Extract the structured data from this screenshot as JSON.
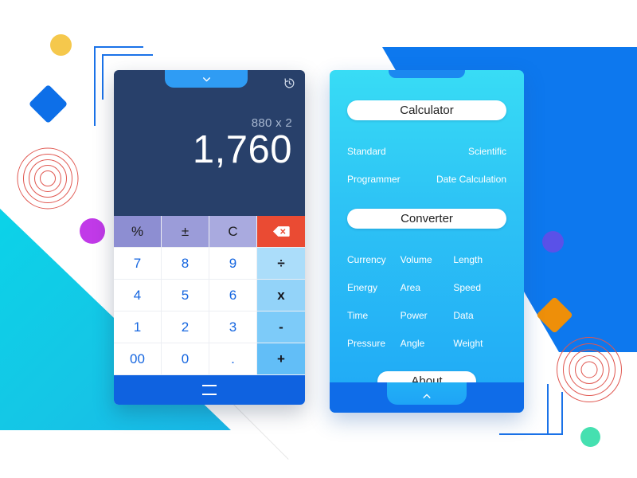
{
  "calculator": {
    "tab_icon": "chevron-down-icon",
    "history_icon": "history-icon",
    "expression": "880 x 2",
    "result": "1,760",
    "keys": [
      {
        "label": "%",
        "name": "percent",
        "style": "fn fn1"
      },
      {
        "label": "±",
        "name": "sign",
        "style": "fn fn2"
      },
      {
        "label": "C",
        "name": "clear",
        "style": "fn fn3"
      },
      {
        "label": "",
        "name": "backspace",
        "style": "fn fn-del"
      },
      {
        "label": "7",
        "name": "seven",
        "style": ""
      },
      {
        "label": "8",
        "name": "eight",
        "style": ""
      },
      {
        "label": "9",
        "name": "nine",
        "style": ""
      },
      {
        "label": "÷",
        "name": "divide",
        "style": "op1"
      },
      {
        "label": "4",
        "name": "four",
        "style": ""
      },
      {
        "label": "5",
        "name": "five",
        "style": ""
      },
      {
        "label": "6",
        "name": "six",
        "style": ""
      },
      {
        "label": "x",
        "name": "multiply",
        "style": "op2"
      },
      {
        "label": "1",
        "name": "one",
        "style": ""
      },
      {
        "label": "2",
        "name": "two",
        "style": ""
      },
      {
        "label": "3",
        "name": "three",
        "style": ""
      },
      {
        "label": "-",
        "name": "subtract",
        "style": "op3"
      },
      {
        "label": "00",
        "name": "double-zero",
        "style": ""
      },
      {
        "label": "0",
        "name": "zero",
        "style": ""
      },
      {
        "label": ".",
        "name": "decimal",
        "style": ""
      },
      {
        "label": "+",
        "name": "add",
        "style": "op4"
      }
    ],
    "equals_label": "="
  },
  "menu": {
    "calculator_title": "Calculator",
    "calculator_modes": [
      "Standard",
      "Scientific",
      "Programmer",
      "Date Calculation"
    ],
    "converter_title": "Converter",
    "converter_items": [
      "Currency",
      "Volume",
      "Length",
      "Energy",
      "Area",
      "Speed",
      "Time",
      "Power",
      "Data",
      "Pressure",
      "Angle",
      "Weight"
    ],
    "about_label": "About",
    "collapse_icon": "chevron-up-icon"
  },
  "decorations": [
    {
      "name": "yellow-circle",
      "color": "#f5c84c"
    },
    {
      "name": "blue-diamond",
      "color": "#0d6fe8"
    },
    {
      "name": "red-concentric-rings-left",
      "color": "#e0564f"
    },
    {
      "name": "purple-circle",
      "color": "#c13ae8"
    },
    {
      "name": "cyan-triangle",
      "color": "#0bd3e8"
    },
    {
      "name": "blue-polygon",
      "color": "#0d78ee"
    },
    {
      "name": "violet-circle",
      "color": "#5a51e8"
    },
    {
      "name": "orange-diamond",
      "color": "#ee8f09"
    },
    {
      "name": "red-concentric-rings-right",
      "color": "#e0564f"
    },
    {
      "name": "mint-circle",
      "color": "#45e0b0"
    },
    {
      "name": "blue-corner-bracket",
      "color": "#1a72e8"
    }
  ]
}
